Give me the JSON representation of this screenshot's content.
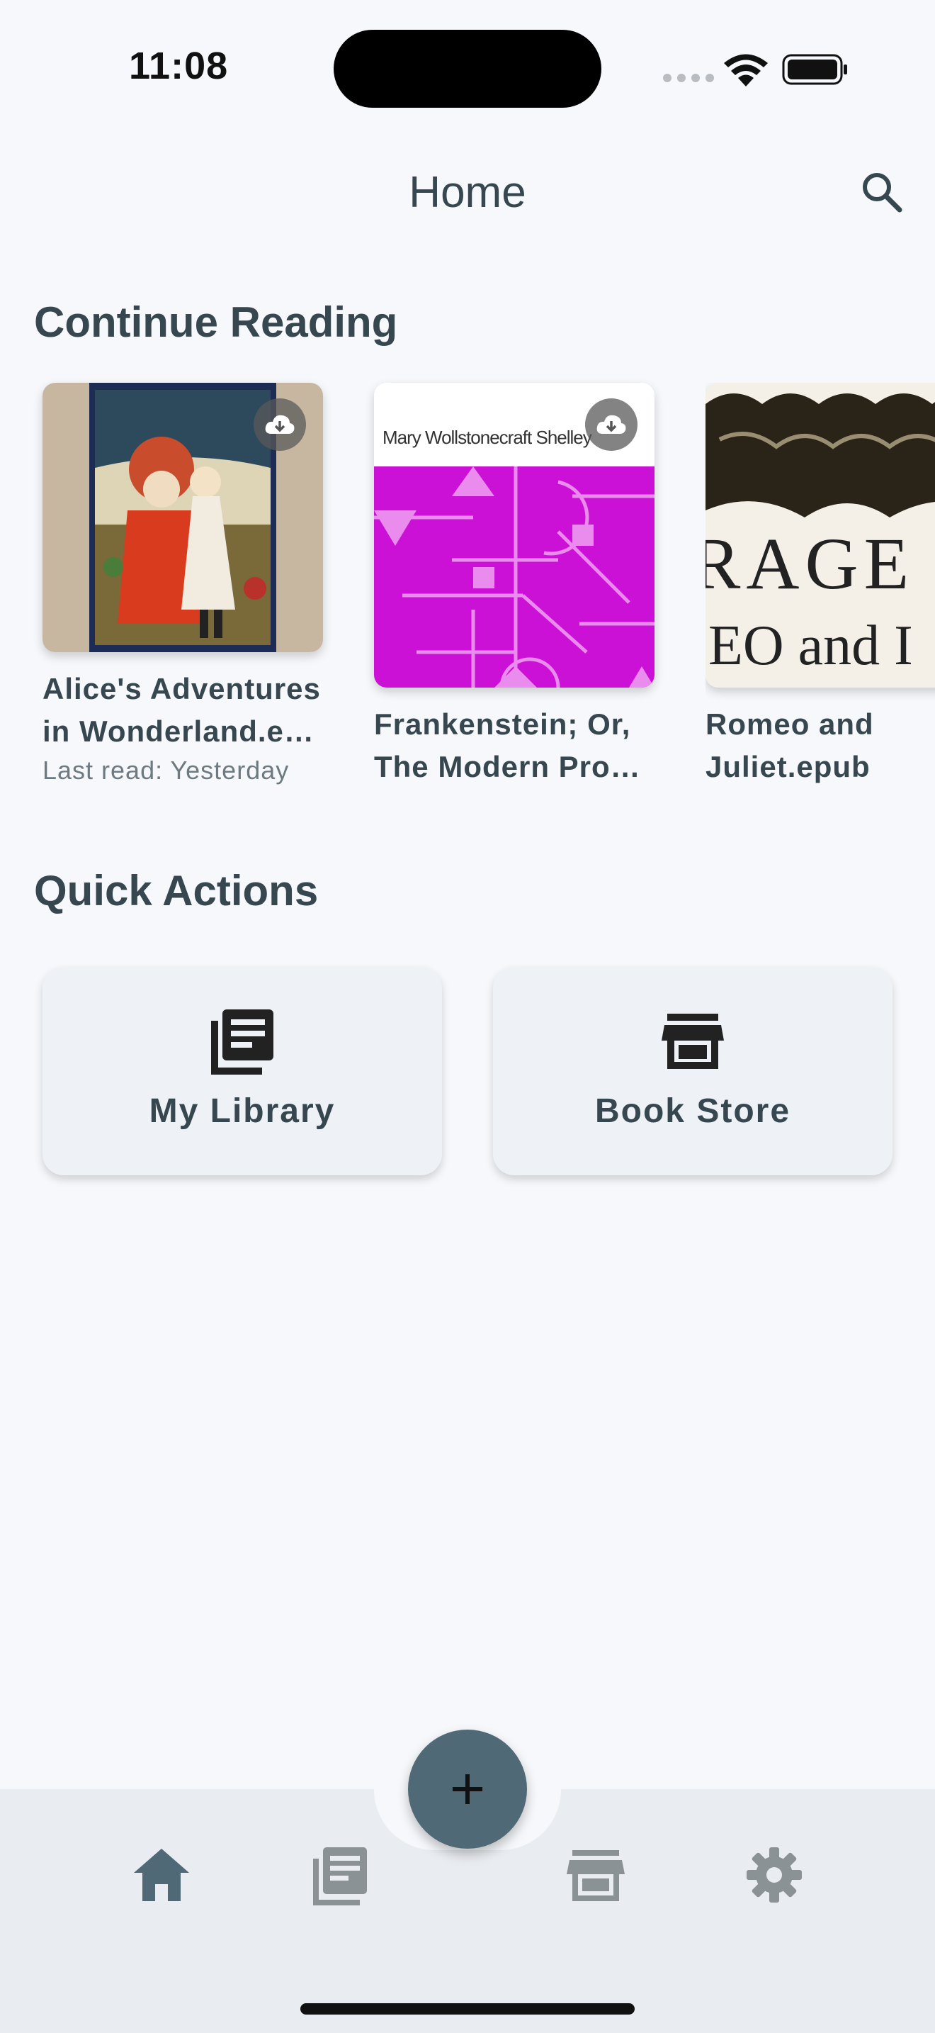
{
  "status_bar": {
    "time": "11:08"
  },
  "app_bar": {
    "title": "Home",
    "search_icon": "search-icon"
  },
  "continue_reading": {
    "title": "Continue Reading",
    "books": [
      {
        "title_line1": "Alice's Adventures",
        "title_line2": "in Wonderland.e…",
        "last_read": "Last read: Yesterday"
      },
      {
        "cover_author": "Mary Wollstonecraft Shelley",
        "title_line1": "Frankenstein; Or,",
        "title_line2": "The Modern Pro…"
      },
      {
        "cover_text1": "RAGE",
        "cover_text2": "EO and I",
        "title_line1": "Romeo and",
        "title_line2": "Juliet.epub"
      }
    ]
  },
  "quick_actions": {
    "title": "Quick Actions",
    "items": [
      {
        "label": "My Library",
        "icon": "library-icon"
      },
      {
        "label": "Book Store",
        "icon": "store-icon"
      }
    ]
  },
  "bottom_nav": {
    "items": [
      "home-icon",
      "library-icon",
      "store-icon",
      "settings-icon"
    ],
    "fab_icon": "plus-icon"
  },
  "colors": {
    "accent": "#4f6976",
    "text": "#37474f",
    "background": "#f6f8fb",
    "nav_bg": "#e9ecf1"
  }
}
